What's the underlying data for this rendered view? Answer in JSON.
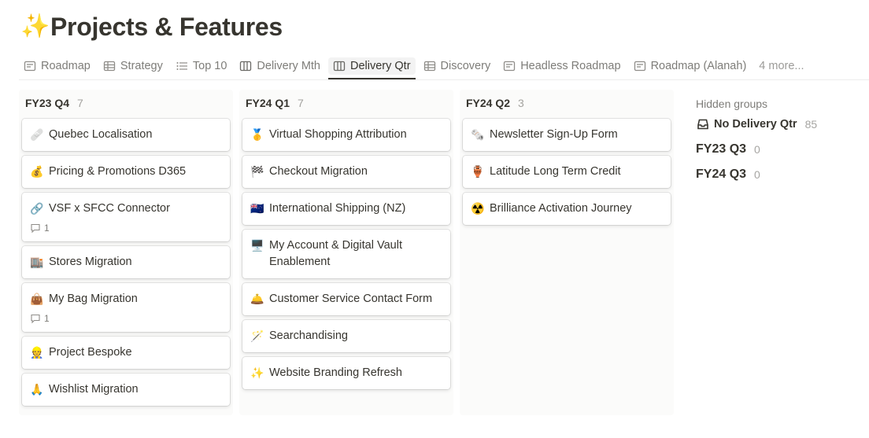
{
  "page": {
    "title_emoji": "✨",
    "title": "Projects & Features"
  },
  "tabs": [
    {
      "label": "Roadmap",
      "icon": "list-window-icon",
      "active": false
    },
    {
      "label": "Strategy",
      "icon": "table-icon",
      "active": false
    },
    {
      "label": "Top 10",
      "icon": "bulleted-list-icon",
      "active": false
    },
    {
      "label": "Delivery Mth",
      "icon": "board-icon",
      "active": false
    },
    {
      "label": "Delivery Qtr",
      "icon": "board-icon",
      "active": true
    },
    {
      "label": "Discovery",
      "icon": "table-icon",
      "active": false
    },
    {
      "label": "Headless Roadmap",
      "icon": "list-window-icon",
      "active": false
    },
    {
      "label": "Roadmap (Alanah)",
      "icon": "list-window-icon",
      "active": false
    }
  ],
  "tabs_more": "4 more...",
  "columns": [
    {
      "title": "FY23 Q4",
      "count": "7",
      "cards": [
        {
          "emoji": "🩹",
          "title": "Quebec Localisation",
          "comments": ""
        },
        {
          "emoji": "💰",
          "title": "Pricing & Promotions D365",
          "comments": ""
        },
        {
          "emoji": "🔗",
          "title": "VSF x SFCC Connector",
          "comments": "1"
        },
        {
          "emoji": "🏬",
          "title": "Stores Migration",
          "comments": ""
        },
        {
          "emoji": "👜",
          "title": "My Bag Migration",
          "comments": "1"
        },
        {
          "emoji": "👷",
          "title": "Project Bespoke",
          "comments": ""
        },
        {
          "emoji": "🙏",
          "title": "Wishlist Migration",
          "comments": ""
        }
      ]
    },
    {
      "title": "FY24 Q1",
      "count": "7",
      "cards": [
        {
          "emoji": "🥇",
          "title": "Virtual Shopping Attribution",
          "comments": ""
        },
        {
          "emoji": "🏁",
          "title": "Checkout Migration",
          "comments": ""
        },
        {
          "emoji": "🇳🇿",
          "title": "International Shipping (NZ)",
          "comments": ""
        },
        {
          "emoji": "🖥️",
          "title": "My Account & Digital Vault Enablement",
          "comments": ""
        },
        {
          "emoji": "🛎️",
          "title": "Customer Service Contact Form",
          "comments": ""
        },
        {
          "emoji": "🪄",
          "title": "Searchandising",
          "comments": ""
        },
        {
          "emoji": "✨",
          "title": "Website Branding Refresh",
          "comments": ""
        }
      ]
    },
    {
      "title": "FY24 Q2",
      "count": "3",
      "cards": [
        {
          "emoji": "🗞️",
          "title": "Newsletter Sign-Up Form",
          "comments": ""
        },
        {
          "emoji": "🏺",
          "title": "Latitude Long Term Credit",
          "comments": ""
        },
        {
          "emoji": "☢️",
          "title": "Brilliance Activation Journey",
          "comments": ""
        }
      ]
    }
  ],
  "hidden_groups": {
    "label": "Hidden groups",
    "items": [
      {
        "name": "No Delivery Qtr",
        "count": "85",
        "icon": "inbox-icon"
      },
      {
        "name": "FY23 Q3",
        "count": "0",
        "icon": ""
      },
      {
        "name": "FY24 Q3",
        "count": "0",
        "icon": ""
      }
    ]
  },
  "colors": {
    "text": "#37352f",
    "column_bg": "#fbfbfa",
    "card_bg": "#ffffff"
  }
}
